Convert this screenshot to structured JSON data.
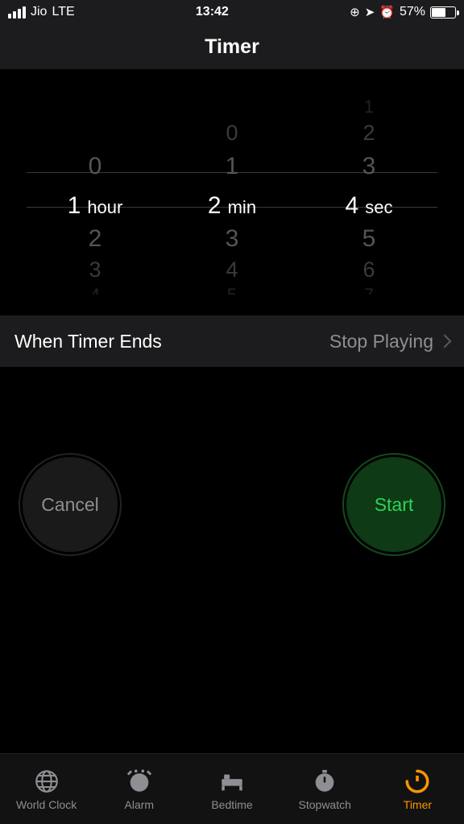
{
  "status": {
    "carrier": "Jio",
    "network": "LTE",
    "time": "13:42",
    "battery_pct": "57%"
  },
  "title": "Timer",
  "picker": {
    "hour": {
      "selected": "1",
      "unit": "hour",
      "above": [
        "0"
      ],
      "below": [
        "2",
        "3",
        "4"
      ]
    },
    "min": {
      "selected": "2",
      "unit": "min",
      "above": [
        "1",
        "0"
      ],
      "below": [
        "3",
        "4",
        "5"
      ]
    },
    "sec": {
      "selected": "4",
      "unit": "sec",
      "above": [
        "3",
        "2",
        "1"
      ],
      "below": [
        "5",
        "6",
        "7"
      ]
    }
  },
  "when_ends": {
    "label": "When Timer Ends",
    "value": "Stop Playing"
  },
  "buttons": {
    "cancel": "Cancel",
    "start": "Start"
  },
  "tabs": {
    "world_clock": "World Clock",
    "alarm": "Alarm",
    "bedtime": "Bedtime",
    "stopwatch": "Stopwatch",
    "timer": "Timer"
  }
}
